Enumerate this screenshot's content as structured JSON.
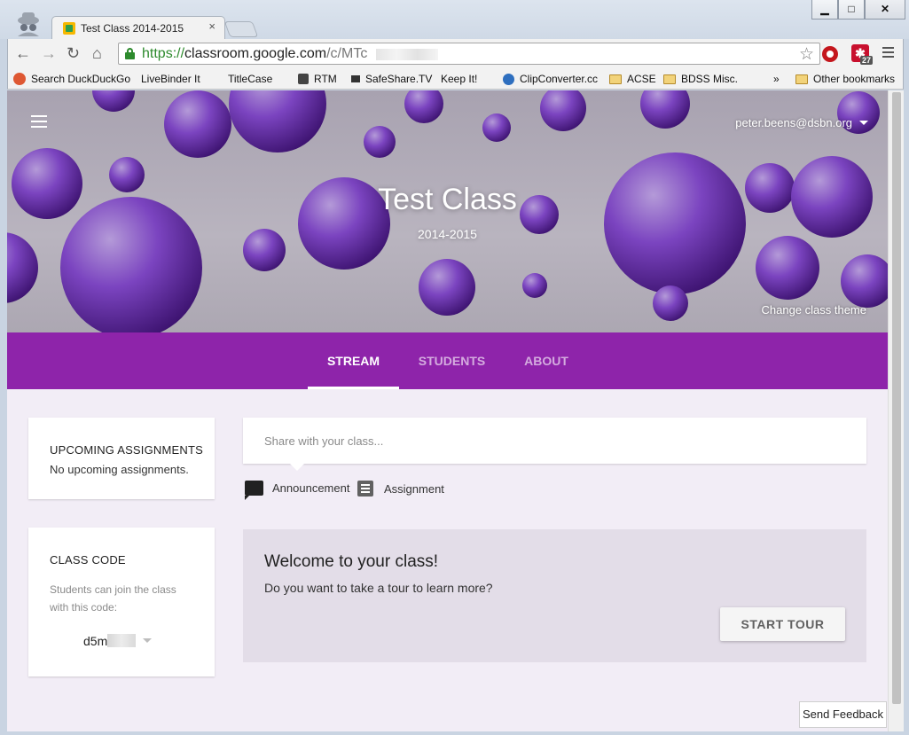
{
  "browser": {
    "tab_title": "Test Class 2014-2015",
    "tab_close": "×",
    "window_buttons": {
      "minimize": "▁",
      "maximize": "□",
      "close": "✕"
    },
    "url_scheme": "https://",
    "url_host": "classroom.google.com",
    "url_path": "/c/MTc",
    "nav": {
      "back": "←",
      "forward": "→",
      "reload": "↻",
      "home": "⌂",
      "star": "☆"
    },
    "extension_badge": "27",
    "extension_symbol": "✱",
    "bookmarks": [
      {
        "label": "Search DuckDuckGo",
        "icon": "duckduckgo-icon"
      },
      {
        "label": "LiveBinder It",
        "icon": "page-icon"
      },
      {
        "label": "TitleCase",
        "icon": "page-icon"
      },
      {
        "label": "RTM",
        "icon": "rtm-icon"
      },
      {
        "label": "SafeShare.TV",
        "icon": "tv-icon"
      },
      {
        "label": "Keep It!",
        "icon": "page-icon"
      },
      {
        "label": "ClipConverter.cc",
        "icon": "clipconverter-icon"
      },
      {
        "label": "ACSE",
        "icon": "folder-icon"
      },
      {
        "label": "BDSS Misc.",
        "icon": "folder-icon"
      }
    ],
    "bookmarks_overflow": "»",
    "other_bookmarks": "Other bookmarks"
  },
  "header": {
    "account_email": "peter.beens@dsbn.org",
    "class_title": "Test Class",
    "class_subtitle": "2014-2015",
    "change_theme": "Change class theme"
  },
  "tabs": [
    {
      "label": "STREAM",
      "active": true
    },
    {
      "label": "STUDENTS",
      "active": false
    },
    {
      "label": "ABOUT",
      "active": false
    }
  ],
  "sidebar": {
    "upcoming_heading": "UPCOMING ASSIGNMENTS",
    "upcoming_text": "No upcoming assignments.",
    "code_heading": "CLASS CODE",
    "code_help": "Students can join the class with this code:",
    "code_value": "d5m"
  },
  "stream": {
    "share_placeholder": "Share with your class...",
    "announcement_label": "Announcement",
    "assignment_label": "Assignment",
    "welcome_title": "Welcome to your class!",
    "welcome_body": "Do you want to take a tour to learn more?",
    "start_tour": "START TOUR"
  },
  "feedback_label": "Send Feedback",
  "colors": {
    "accent": "#8e24aa",
    "page_background": "#f2edf6",
    "welcome_background": "#e3dde8"
  }
}
